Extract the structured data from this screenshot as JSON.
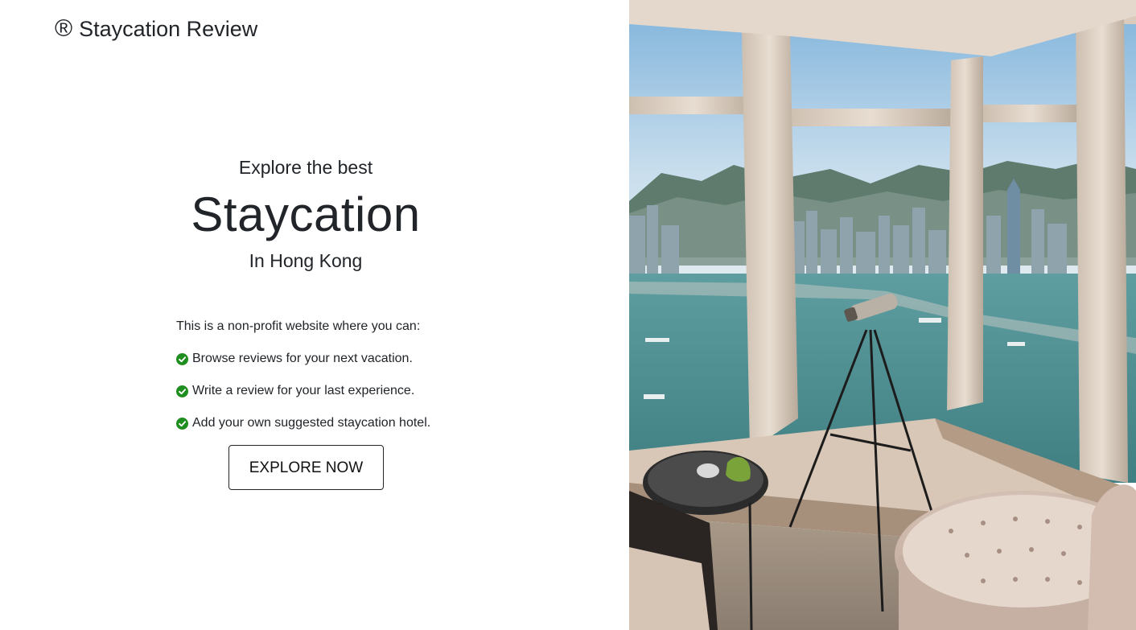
{
  "brand": {
    "icon": "registered-icon",
    "symbol": "®",
    "name": "Staycation Review"
  },
  "hero": {
    "eyebrow": "Explore the best",
    "headline": "Staycation",
    "location": "In Hong Kong",
    "intro": "This is a non-profit website where you can:",
    "features": [
      "Browse reviews for your next vacation.",
      "Write a review for your last experience.",
      "Add your own suggested staycation hotel."
    ],
    "cta_label": "EXPLORE NOW"
  },
  "colors": {
    "text": "#212529",
    "check": "#1e8e1e",
    "background": "#ffffff"
  },
  "photo": {
    "subject": "hotel room window overlooking Victoria Harbour with telescope"
  }
}
